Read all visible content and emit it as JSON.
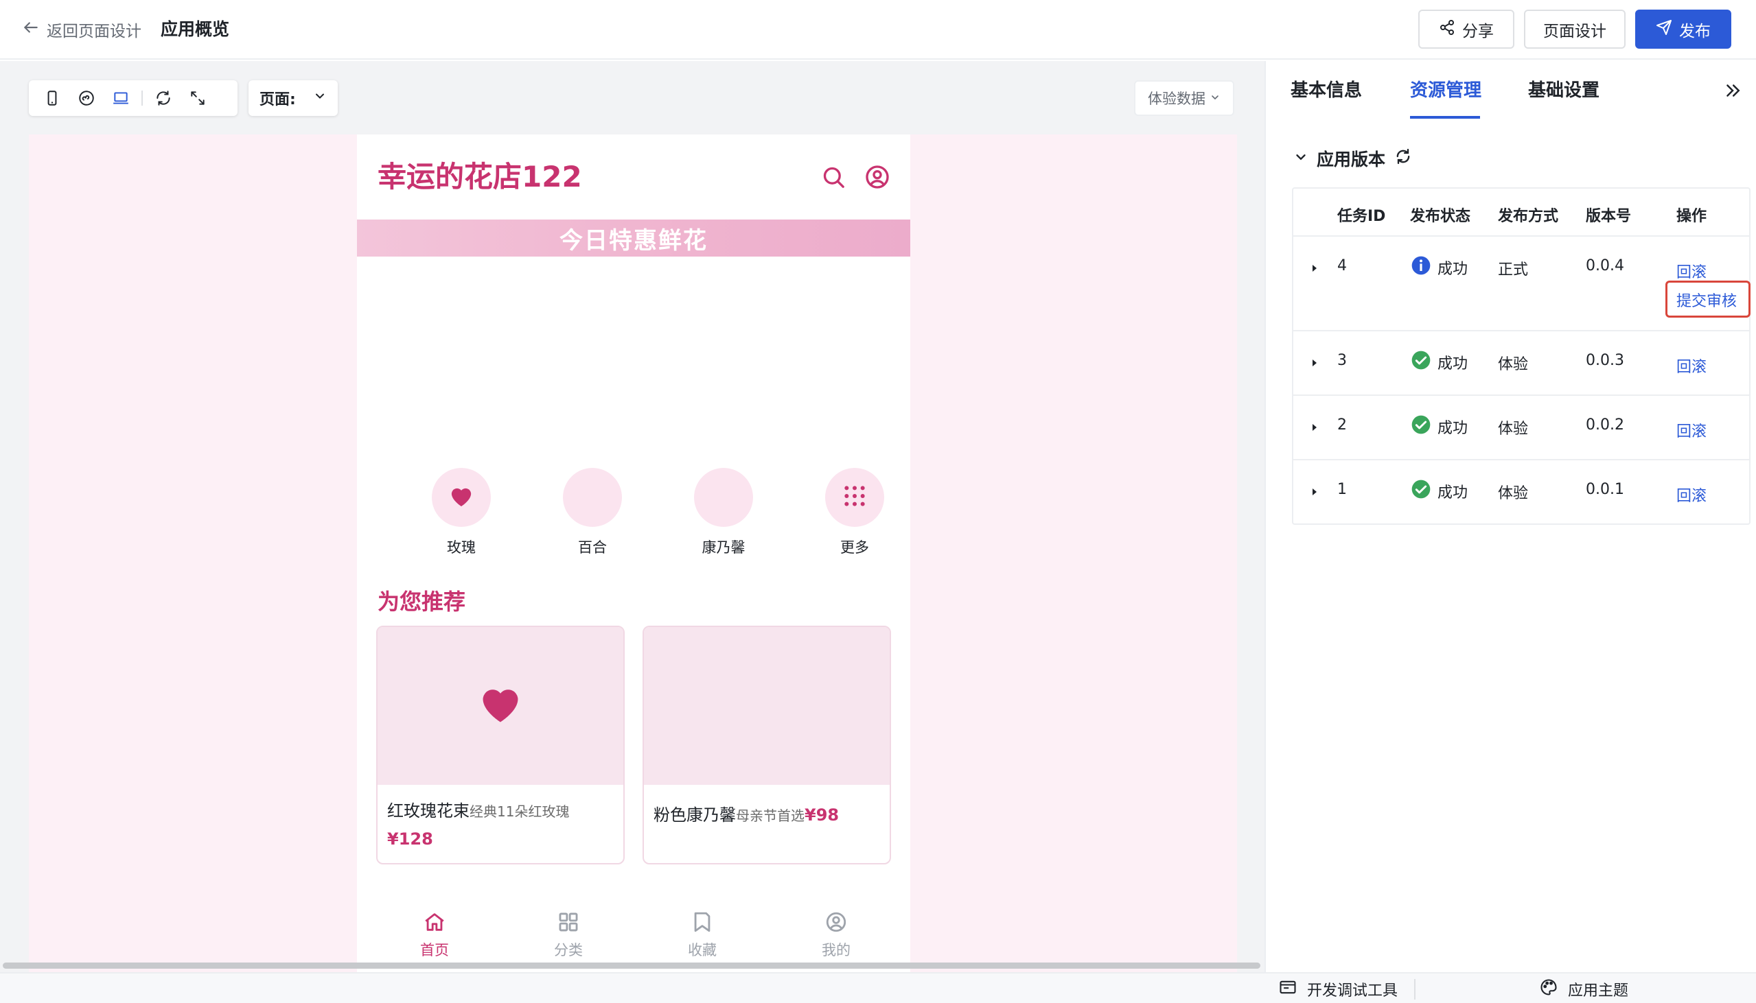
{
  "header": {
    "back_label": "返回页面设计",
    "app_title": "应用概览",
    "share_label": "分享",
    "design_label": "页面设计",
    "publish_label": "发布"
  },
  "canvas": {
    "page_select_label": "页面:",
    "data_select_label": "体验数据"
  },
  "phone": {
    "shop_title": "幸运的花店122",
    "banner_text": "今日特惠鲜花",
    "categories": [
      {
        "label": "玫瑰",
        "icon": "heart-icon"
      },
      {
        "label": "百合",
        "icon": ""
      },
      {
        "label": "康乃馨",
        "icon": ""
      },
      {
        "label": "更多",
        "icon": "grid-dots-icon"
      }
    ],
    "recommend_title": "为您推荐",
    "products": [
      {
        "name": "红玫瑰花束",
        "desc": "经典11朵红玫瑰",
        "price": "¥128"
      },
      {
        "name": "粉色康乃馨",
        "desc": "母亲节首选",
        "price": "¥98"
      }
    ],
    "tabs": [
      {
        "label": "首页",
        "icon": "home-icon",
        "active": true
      },
      {
        "label": "分类",
        "icon": "category-grid-icon",
        "active": false
      },
      {
        "label": "收藏",
        "icon": "bookmark-icon",
        "active": false
      },
      {
        "label": "我的",
        "icon": "user-icon",
        "active": false
      }
    ]
  },
  "panel": {
    "tabs": [
      "基本信息",
      "资源管理",
      "基础设置"
    ],
    "active_tab": "资源管理",
    "section_title": "应用版本",
    "columns": [
      "任务ID",
      "发布状态",
      "发布方式",
      "版本号",
      "操作"
    ],
    "rows": [
      {
        "id": "4",
        "status": "成功",
        "status_icon": "info-icon",
        "mode": "正式",
        "version": "0.0.4",
        "actions": [
          "回滚",
          "提交审核"
        ]
      },
      {
        "id": "3",
        "status": "成功",
        "status_icon": "check-icon",
        "mode": "体验",
        "version": "0.0.3",
        "actions": [
          "回滚"
        ]
      },
      {
        "id": "2",
        "status": "成功",
        "status_icon": "check-icon",
        "mode": "体验",
        "version": "0.0.2",
        "actions": [
          "回滚"
        ]
      },
      {
        "id": "1",
        "status": "成功",
        "status_icon": "check-icon",
        "mode": "体验",
        "version": "0.0.1",
        "actions": [
          "回滚"
        ]
      }
    ]
  },
  "footer": {
    "devtools_label": "开发调试工具",
    "theme_label": "应用主题"
  },
  "colors": {
    "brand_pink": "#c8336f",
    "primary_blue": "#2c5ad7",
    "success_green": "#3aa55b",
    "highlight_red": "#d9463b"
  }
}
